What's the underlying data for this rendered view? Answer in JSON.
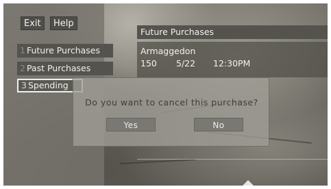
{
  "top_buttons": {
    "exit": "Exit",
    "help": "Help"
  },
  "menu": {
    "items": [
      {
        "number": "1",
        "label": "Future Purchases"
      },
      {
        "number": "2",
        "label": "Past Purchases"
      },
      {
        "number": "3",
        "label": "Spending"
      }
    ]
  },
  "info": {
    "header": "Future Purchases",
    "title": "Armaggedon",
    "channel": "150",
    "date": "5/22",
    "time": "12:30PM"
  },
  "dialog": {
    "message": "Do you want to cancel this purchase?",
    "yes_label": "Yes",
    "no_label": "No"
  }
}
